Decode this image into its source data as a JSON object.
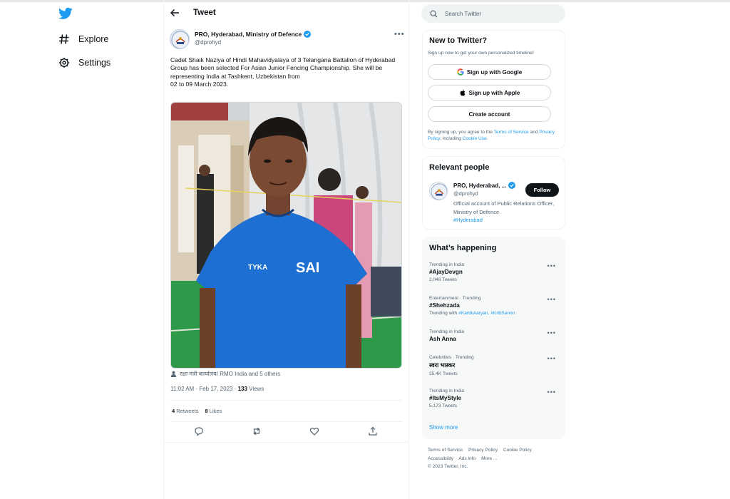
{
  "nav": {
    "items": [
      {
        "label": "Explore",
        "icon": "hashtag-icon"
      },
      {
        "label": "Settings",
        "icon": "gear-icon"
      }
    ]
  },
  "header": {
    "title": "Tweet"
  },
  "tweet": {
    "author_name": "PRO, Hyderabad, Ministry of Defence",
    "author_handle": "@dprohyd",
    "text": "Cadet Shaik Naziya of Hindi Mahavidyalaya of 3 Telangana Battalion of Hyderabad Group has been selected For Asian Junior Fencing Championship. She will be representing India at Tashkent, Uzbekistan from\n02 to 09 March  2023.",
    "photo_shirt_text_left": "TYKA",
    "photo_shirt_text_right": "SAI",
    "tagged": "रक्षा मंत्री कार्यालय/ RMO India and 5 others",
    "time": "11:02 AM · Feb 17, 2023 · ",
    "views_count": "133",
    "views_label": " Views",
    "retweets_count": "4",
    "retweets_label": " Retweets",
    "likes_count": "8",
    "likes_label": " Likes"
  },
  "search": {
    "placeholder": "Search Twitter"
  },
  "new_to_twitter": {
    "title": "New to Twitter?",
    "subtitle": "Sign up now to get your own personalized timeline!",
    "google_label": "Sign up with Google",
    "apple_label": "Sign up with Apple",
    "create_label": "Create account",
    "legal_prefix": "By signing up, you agree to the ",
    "terms_link": "Terms of Service",
    "legal_and": " and ",
    "privacy_link": "Privacy Policy",
    "legal_including": ", including ",
    "cookie_link": "Cookie Use",
    "legal_end": "."
  },
  "relevant_people": {
    "title": "Relevant people",
    "name": "PRO, Hyderabad, ...",
    "handle": "@dprohyd",
    "follow_label": "Follow",
    "bio": "Official account of Public Relations Officer, Ministry of Defence",
    "bio_tag": "#Hyderabad"
  },
  "whats_happening": {
    "title": "What’s happening",
    "trends": [
      {
        "category": "Trending in India",
        "name": "#AjayDevgn",
        "count": "2,048 Tweets"
      },
      {
        "category": "Entertainment · Trending",
        "name": "#Shehzada",
        "with_prefix": "Trending with ",
        "with_tags": "#KartikAaryan, #KritiSanon"
      },
      {
        "category": "Trending in India",
        "name": "Ash Anna"
      },
      {
        "category": "Celebrities · Trending",
        "name": "स्वरा भास्कर",
        "count": "25.4K Tweets"
      },
      {
        "category": "Trending in India",
        "name": "#ItsMyStyle",
        "count": "5,173 Tweets"
      }
    ],
    "show_more": "Show more"
  },
  "footer": {
    "links": [
      "Terms of Service",
      "Privacy Policy",
      "Cookie Policy",
      "Accessibility",
      "Ads info",
      "More ..."
    ],
    "copyright": "© 2023 Twitter, Inc."
  },
  "colors": {
    "brand": "#1d9bf0",
    "text": "#0f1419",
    "muted": "#536471",
    "border": "#eff3f4"
  }
}
